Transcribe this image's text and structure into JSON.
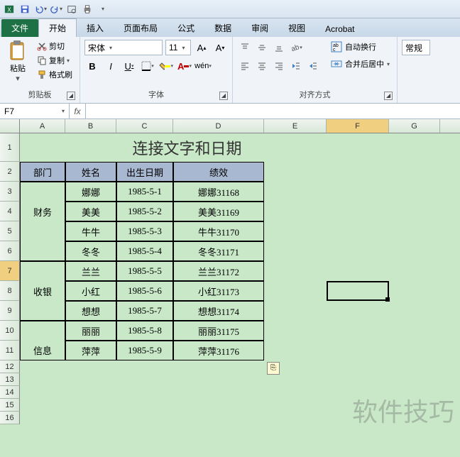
{
  "qat": {
    "save": "保存",
    "undo": "撤销",
    "redo": "重做"
  },
  "tabs": {
    "file": "文件",
    "home": "开始",
    "insert": "插入",
    "layout": "页面布局",
    "formula": "公式",
    "data": "数据",
    "review": "审阅",
    "view": "视图",
    "acrobat": "Acrobat"
  },
  "ribbon": {
    "clipboard": {
      "paste": "粘贴",
      "cut": "剪切",
      "copy": "复制",
      "painter": "格式刷",
      "label": "剪贴板"
    },
    "font": {
      "name": "宋体",
      "size": "11",
      "label": "字体"
    },
    "align": {
      "wrap": "自动换行",
      "merge": "合并后居中",
      "label": "对齐方式"
    },
    "number": {
      "label": "常规"
    }
  },
  "fbar": {
    "cell": "F7",
    "fx": "fx",
    "value": ""
  },
  "cols": [
    "A",
    "B",
    "C",
    "D",
    "E",
    "F",
    "G"
  ],
  "rows": [
    "1",
    "2",
    "3",
    "4",
    "5",
    "6",
    "7",
    "8",
    "9",
    "10",
    "11",
    "12",
    "13",
    "14",
    "15",
    "16"
  ],
  "title": "连接文字和日期",
  "headers": {
    "dept": "部门",
    "name": "姓名",
    "dob": "出生日期",
    "perf": "绩效"
  },
  "data": [
    {
      "dept": "财务",
      "name": "娜娜",
      "dob": "1985-5-1",
      "perf": "娜娜31168"
    },
    {
      "dept": "",
      "name": "美美",
      "dob": "1985-5-2",
      "perf": "美美31169"
    },
    {
      "dept": "",
      "name": "牛牛",
      "dob": "1985-5-3",
      "perf": "牛牛31170"
    },
    {
      "dept": "",
      "name": "冬冬",
      "dob": "1985-5-4",
      "perf": "冬冬31171"
    },
    {
      "dept": "收银",
      "name": "兰兰",
      "dob": "1985-5-5",
      "perf": "兰兰31172"
    },
    {
      "dept": "",
      "name": "小红",
      "dob": "1985-5-6",
      "perf": "小红31173"
    },
    {
      "dept": "",
      "name": "想想",
      "dob": "1985-5-7",
      "perf": "想想31174"
    },
    {
      "dept": "信息",
      "name": "丽丽",
      "dob": "1985-5-8",
      "perf": "丽丽31175"
    },
    {
      "dept": "",
      "name": "萍萍",
      "dob": "1985-5-9",
      "perf": "萍萍31176"
    }
  ],
  "dept_groups": [
    "财务",
    "收银",
    "信息"
  ],
  "watermark": "软件技巧"
}
